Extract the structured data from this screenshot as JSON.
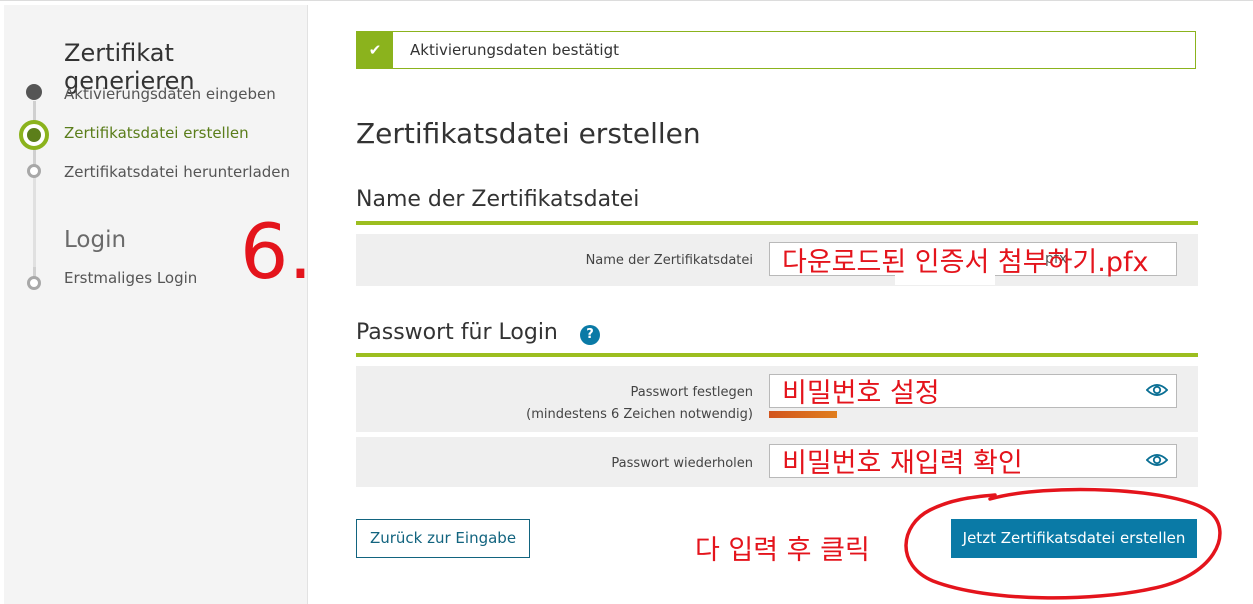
{
  "sidebar": {
    "section1_title": "Zertifikat generieren",
    "steps": [
      {
        "label": "Aktivierungsdaten eingeben",
        "state": "done"
      },
      {
        "label": "Zertifikatsdatei erstellen",
        "state": "active"
      },
      {
        "label": "Zertifikatsdatei herunterladen",
        "state": "todo"
      }
    ],
    "section2_title": "Login",
    "login_steps": [
      {
        "label": "Erstmaliges Login",
        "state": "todo"
      }
    ]
  },
  "alert": {
    "icon": "check-icon",
    "text": "Aktivierungsdaten bestätigt"
  },
  "main": {
    "title": "Zertifikatsdatei erstellen",
    "section_name": {
      "heading": "Name der Zertifikatsdatei",
      "field_label": "Name der Zertifikatsdatei",
      "field_suffix": "pfx"
    },
    "section_password": {
      "heading": "Passwort für Login",
      "help_glyph": "?",
      "set_label": "Passwort festlegen",
      "set_hint": "(mindestens 6 Zeichen notwendig)",
      "repeat_label": "Passwort wiederholen"
    },
    "back_button": "Zurück zur Eingabe",
    "create_button": "Jetzt Zertifikatsdatei erstellen"
  },
  "annotations": {
    "step_number": "6.",
    "filename_note": "다운로드된 인증서 첨부하기.pfx",
    "password_note": "비밀번호 설정",
    "repeat_note": "비밀번호 재입력 확인",
    "click_note": "다 입력 후 클릭"
  },
  "colors": {
    "accent_green": "#8bb31d",
    "primary_blue": "#0a7aa6",
    "annotation_red": "#e4141c"
  }
}
